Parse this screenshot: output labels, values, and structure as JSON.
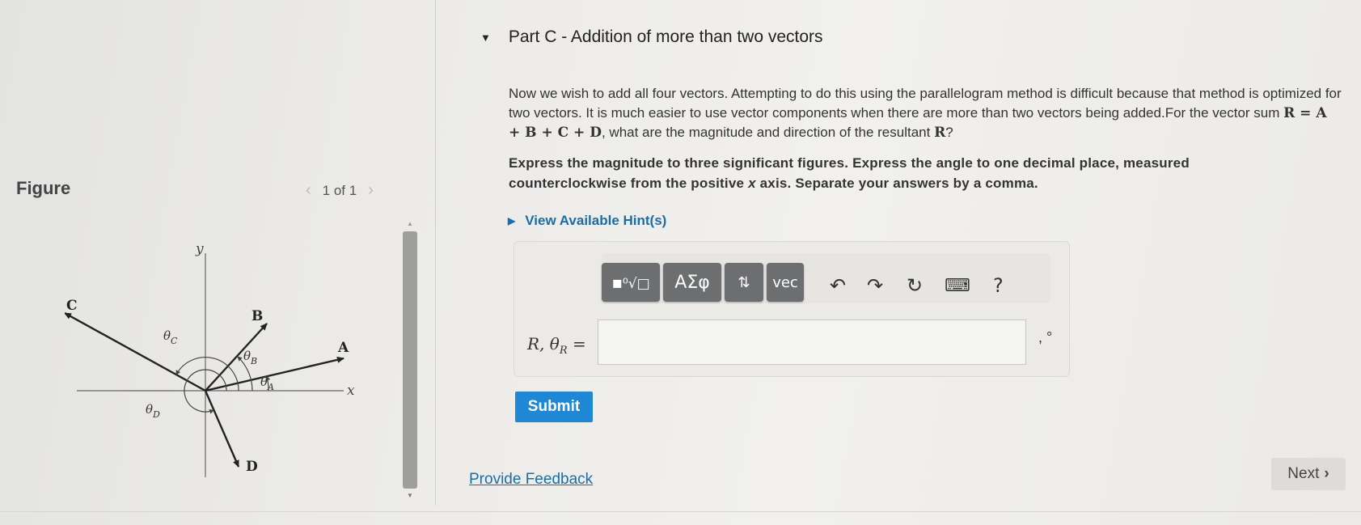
{
  "figure_panel": {
    "title": "Figure",
    "pager": {
      "prev_icon": "chevron-left-icon",
      "text": "1 of 1",
      "next_icon": "chevron-right-icon"
    },
    "diagram_labels": {
      "y_axis": "y",
      "x_axis": "x",
      "A": "A",
      "B": "B",
      "C": "C",
      "D": "D",
      "theta": "θ",
      "sub_A": "A",
      "sub_B": "B",
      "sub_C": "C",
      "sub_D": "D"
    }
  },
  "part": {
    "title": "Part C - Addition of more than two vectors",
    "question_pre": "Now we wish to add all four vectors. Attempting to do this using the parallelogram method is difficult because that method is optimized for two vectors. It is much easier to use vector components when there are more than two vectors being added.For the vector sum ",
    "equation": "R = A + B + C + D",
    "question_mid": ", what are the magnitude and direction of the resultant ",
    "resultant": "R",
    "question_end": "?",
    "instructions_a": "Express the magnitude to three significant figures. Express the angle to one decimal place, measured counterclockwise from the positive ",
    "instructions_x": "x",
    "instructions_b": " axis. Separate your answers by a comma.",
    "hints_label": "View Available Hint(s)"
  },
  "answer": {
    "toolbar": {
      "templates_icon": "templates-icon",
      "greek_label": "ΑΣφ",
      "arrows_icon": "up-down-arrows-icon",
      "vec_label": "vec",
      "undo_icon": "undo-icon",
      "redo_icon": "redo-icon",
      "reset_icon": "reset-icon",
      "keyboard_icon": "keyboard-icon",
      "help_label": "?"
    },
    "label": "R, θR =",
    "value": "",
    "suffix": ", °"
  },
  "submit_label": "Submit",
  "feedback_label": "Provide Feedback",
  "next_label": "Next"
}
